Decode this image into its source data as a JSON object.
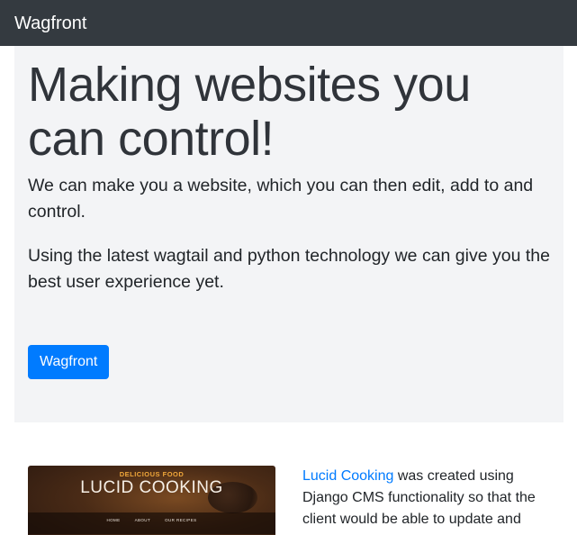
{
  "navbar": {
    "brand": "Wagfront"
  },
  "jumbotron": {
    "heading": "Making websites you can control!",
    "lead_1": "We can make you a website, which you can then edit, add to and control.",
    "lead_2": "Using the latest wagtail and python technology we can give you the best user experience yet.",
    "button_label": "Wagfront"
  },
  "project": {
    "image": {
      "kicker": "DELICIOUS FOOD",
      "title": "LUCID COOKING",
      "menu": [
        "HOME",
        "ABOUT",
        "OUR RECIPES"
      ]
    },
    "link_text": "Lucid Cooking",
    "description_rest": " was created using Django CMS functionality so that the client would be able to update and",
    "accent_color": "#007bff"
  },
  "colors": {
    "navbar_bg": "#343a40",
    "jumbotron_bg": "#f3f4f6",
    "button_bg": "#007bff"
  }
}
